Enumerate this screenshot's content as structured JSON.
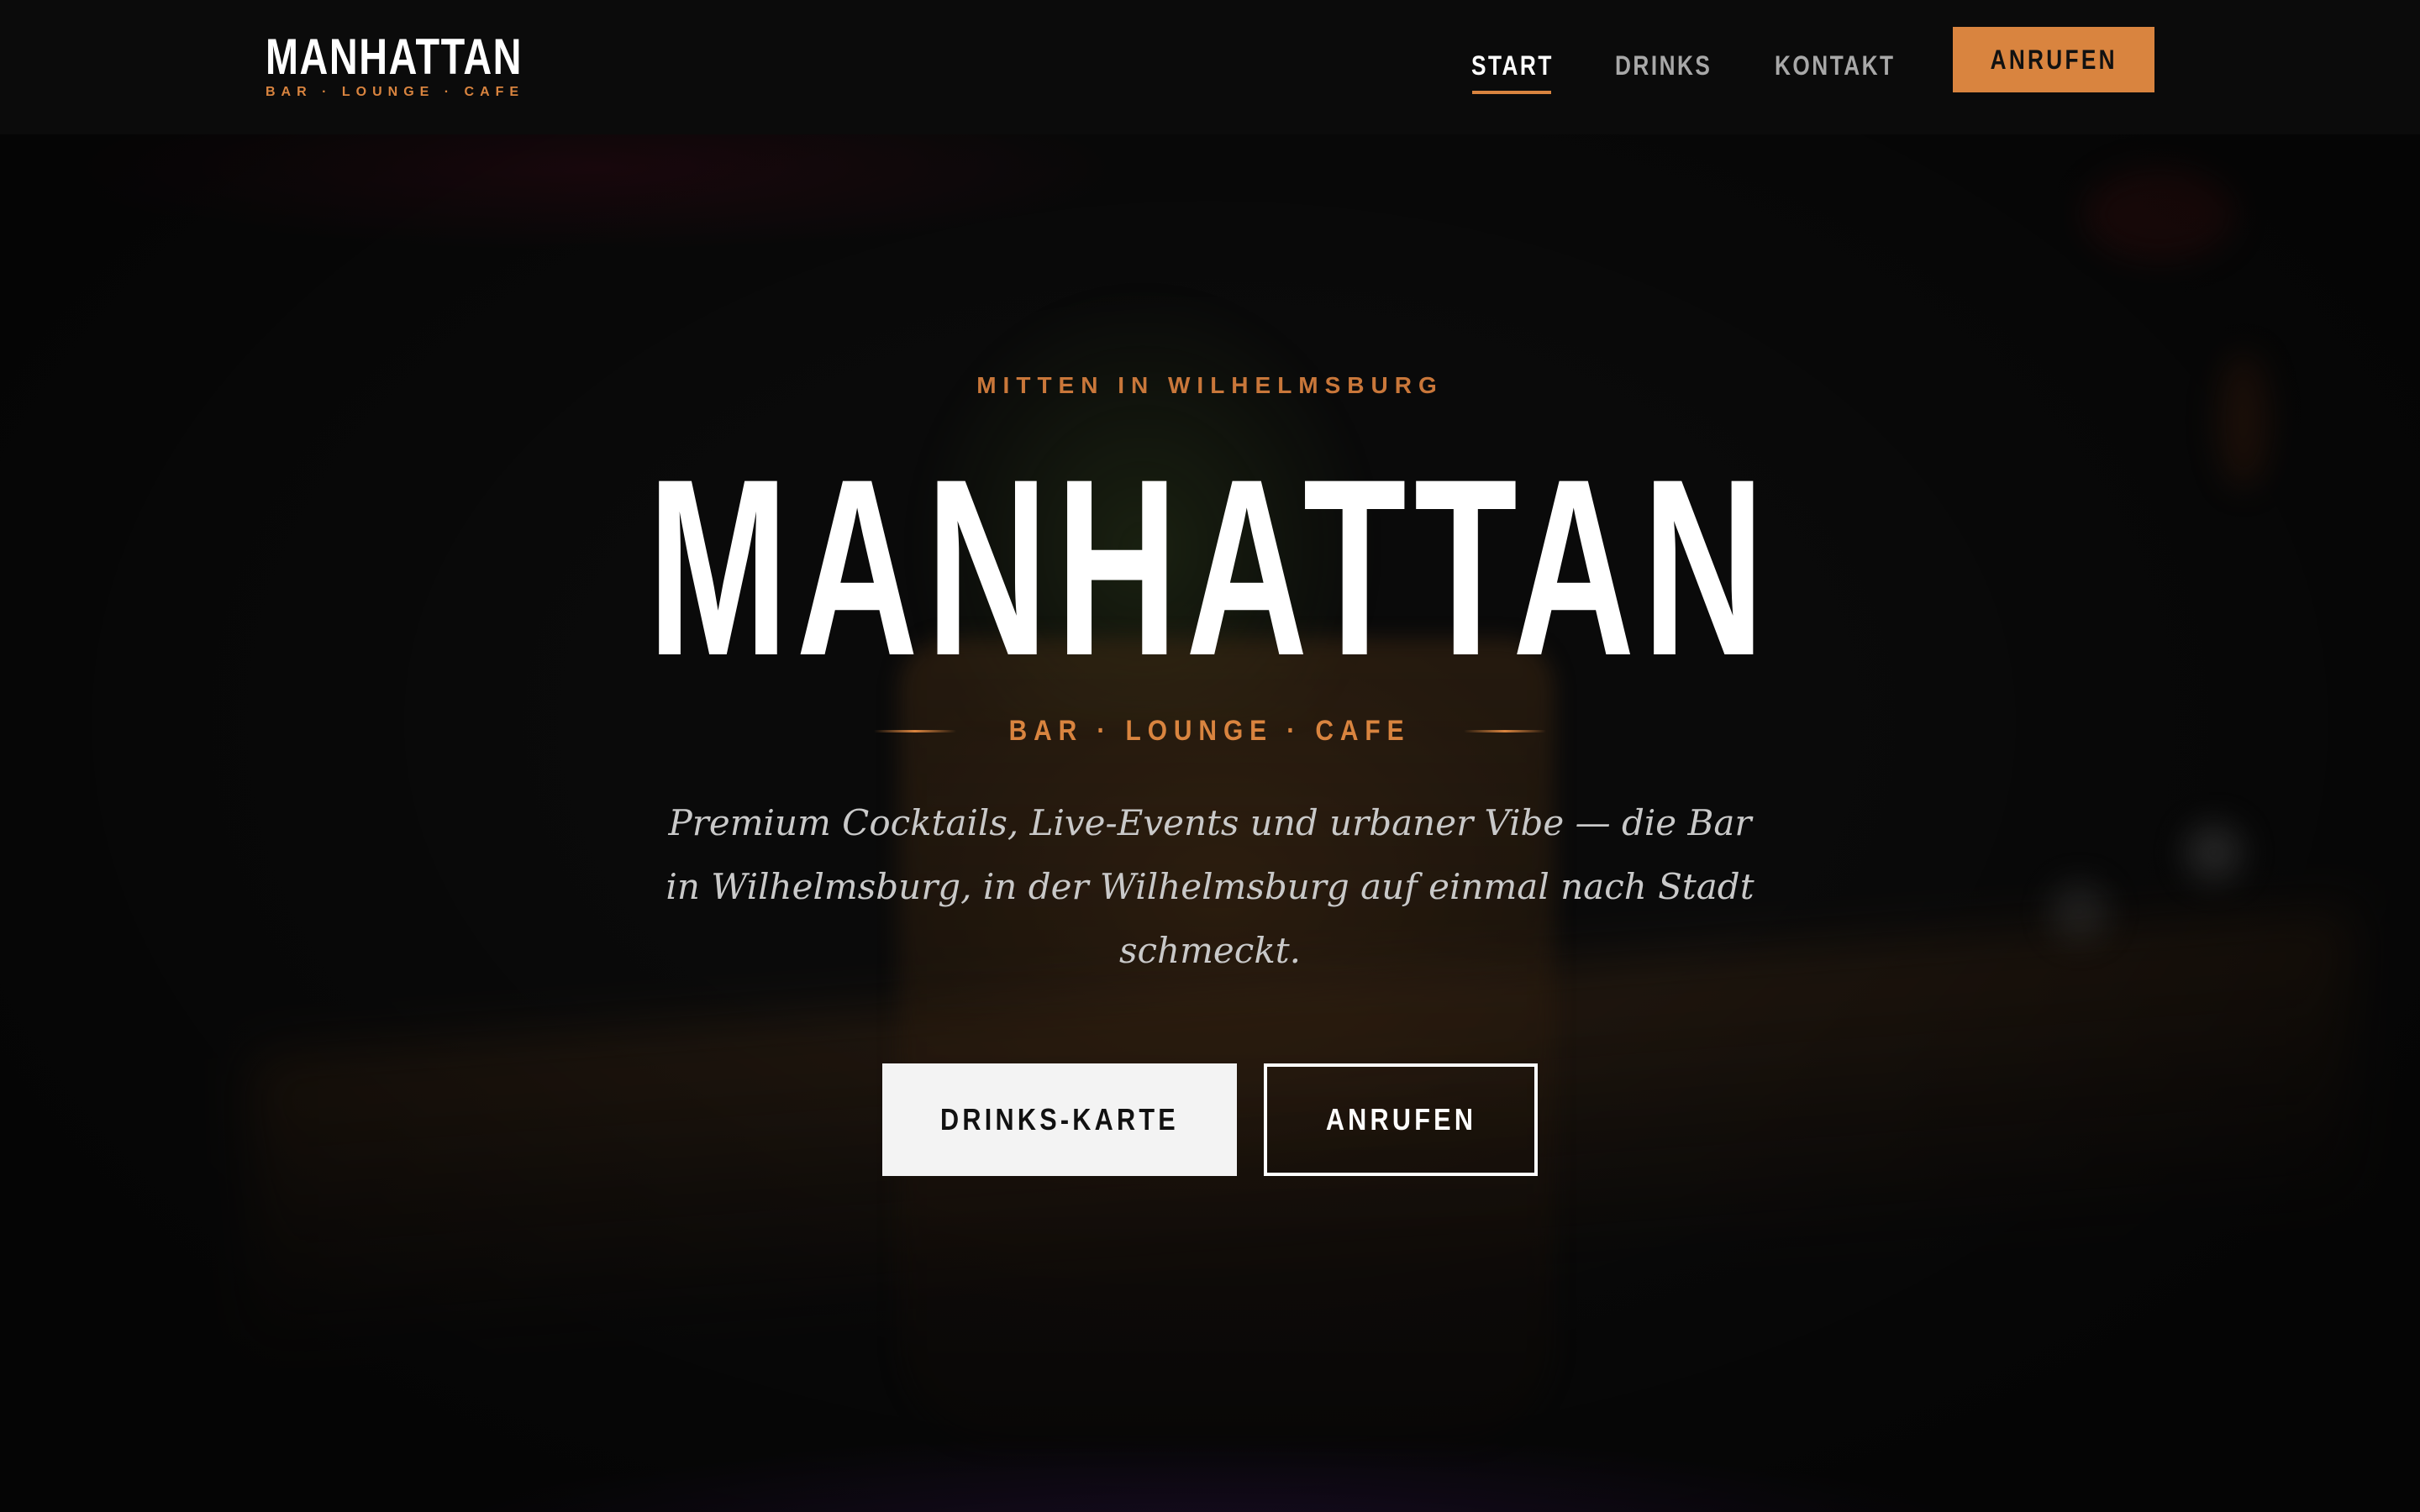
{
  "header": {
    "logo": {
      "title": "MANHATTAN",
      "subtitle": "BAR · LOUNGE · CAFE"
    },
    "nav": [
      {
        "label": "START",
        "active": true
      },
      {
        "label": "DRINKS",
        "active": false
      },
      {
        "label": "KONTAKT",
        "active": false
      }
    ],
    "cta_label": "ANRUFEN"
  },
  "hero": {
    "kicker": "MITTEN IN WILHELMSBURG",
    "title": "MANHATTAN",
    "tagline": "BAR · LOUNGE · CAFE",
    "description": "Premium Cocktails, Live-Events und urbaner Vibe — die Bar in Wilhelmsburg, in der Wilhelmsburg auf einmal nach Stadt schmeckt.",
    "primary_button": "DRINKS-KARTE",
    "secondary_button": "ANRUFEN"
  },
  "colors": {
    "background": "#0a0a0a",
    "accent": "#d9843f",
    "text": "#ffffff",
    "muted": "#a8a8a8"
  }
}
